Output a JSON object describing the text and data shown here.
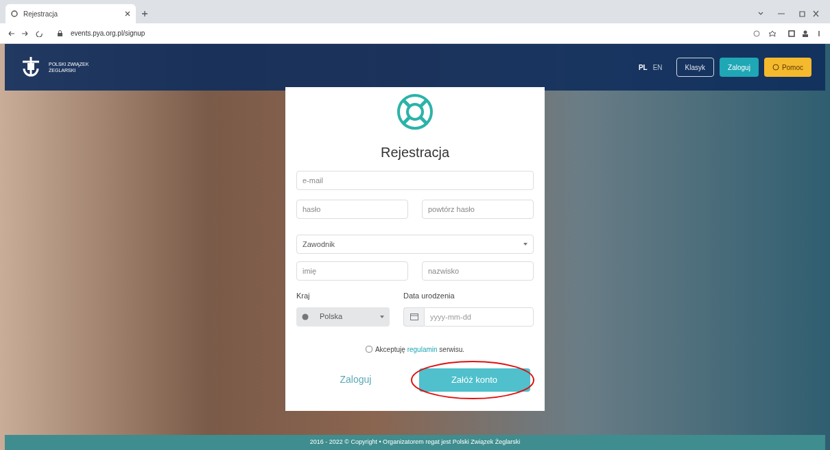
{
  "browser": {
    "tab_title": "Rejestracja",
    "url": "events.pya.org.pl/signup"
  },
  "header": {
    "logo_text": "POLSKI ZWIĄZEK ŻEGLARSKI",
    "languages": [
      {
        "label": "PL",
        "selected": true
      },
      {
        "label": "EN",
        "selected": false
      }
    ],
    "buttons": [
      {
        "label": "Klasyk",
        "kind": "outline"
      },
      {
        "label": "Zaloguj",
        "kind": "primary"
      },
      {
        "label": "Pomoc",
        "kind": "help"
      }
    ]
  },
  "form": {
    "title": "Rejestracja",
    "email": {
      "placeholder": "e-mail"
    },
    "password": {
      "placeholder": "hasło"
    },
    "repeat_password": {
      "placeholder": "powtórz hasło"
    },
    "role": {
      "value": "Zawodnik"
    },
    "first_name": {
      "placeholder": "imię"
    },
    "last_name": {
      "placeholder": "nazwisko"
    },
    "country": {
      "label": "Kraj",
      "value": "Polska"
    },
    "birth_date": {
      "label": "Data urodzenia",
      "placeholder": "yyyy-mm-dd"
    },
    "terms": {
      "checked": false,
      "before": "Akceptuję",
      "link": "regulamin",
      "after": "serwisu."
    },
    "login_link": "Zaloguj",
    "submit": "Załóż konto",
    "highlighted": true
  },
  "footer": {
    "text": "2016 - 2022 © Copyright • Organizatorem regat jest Polski Związek Żeglarski"
  }
}
